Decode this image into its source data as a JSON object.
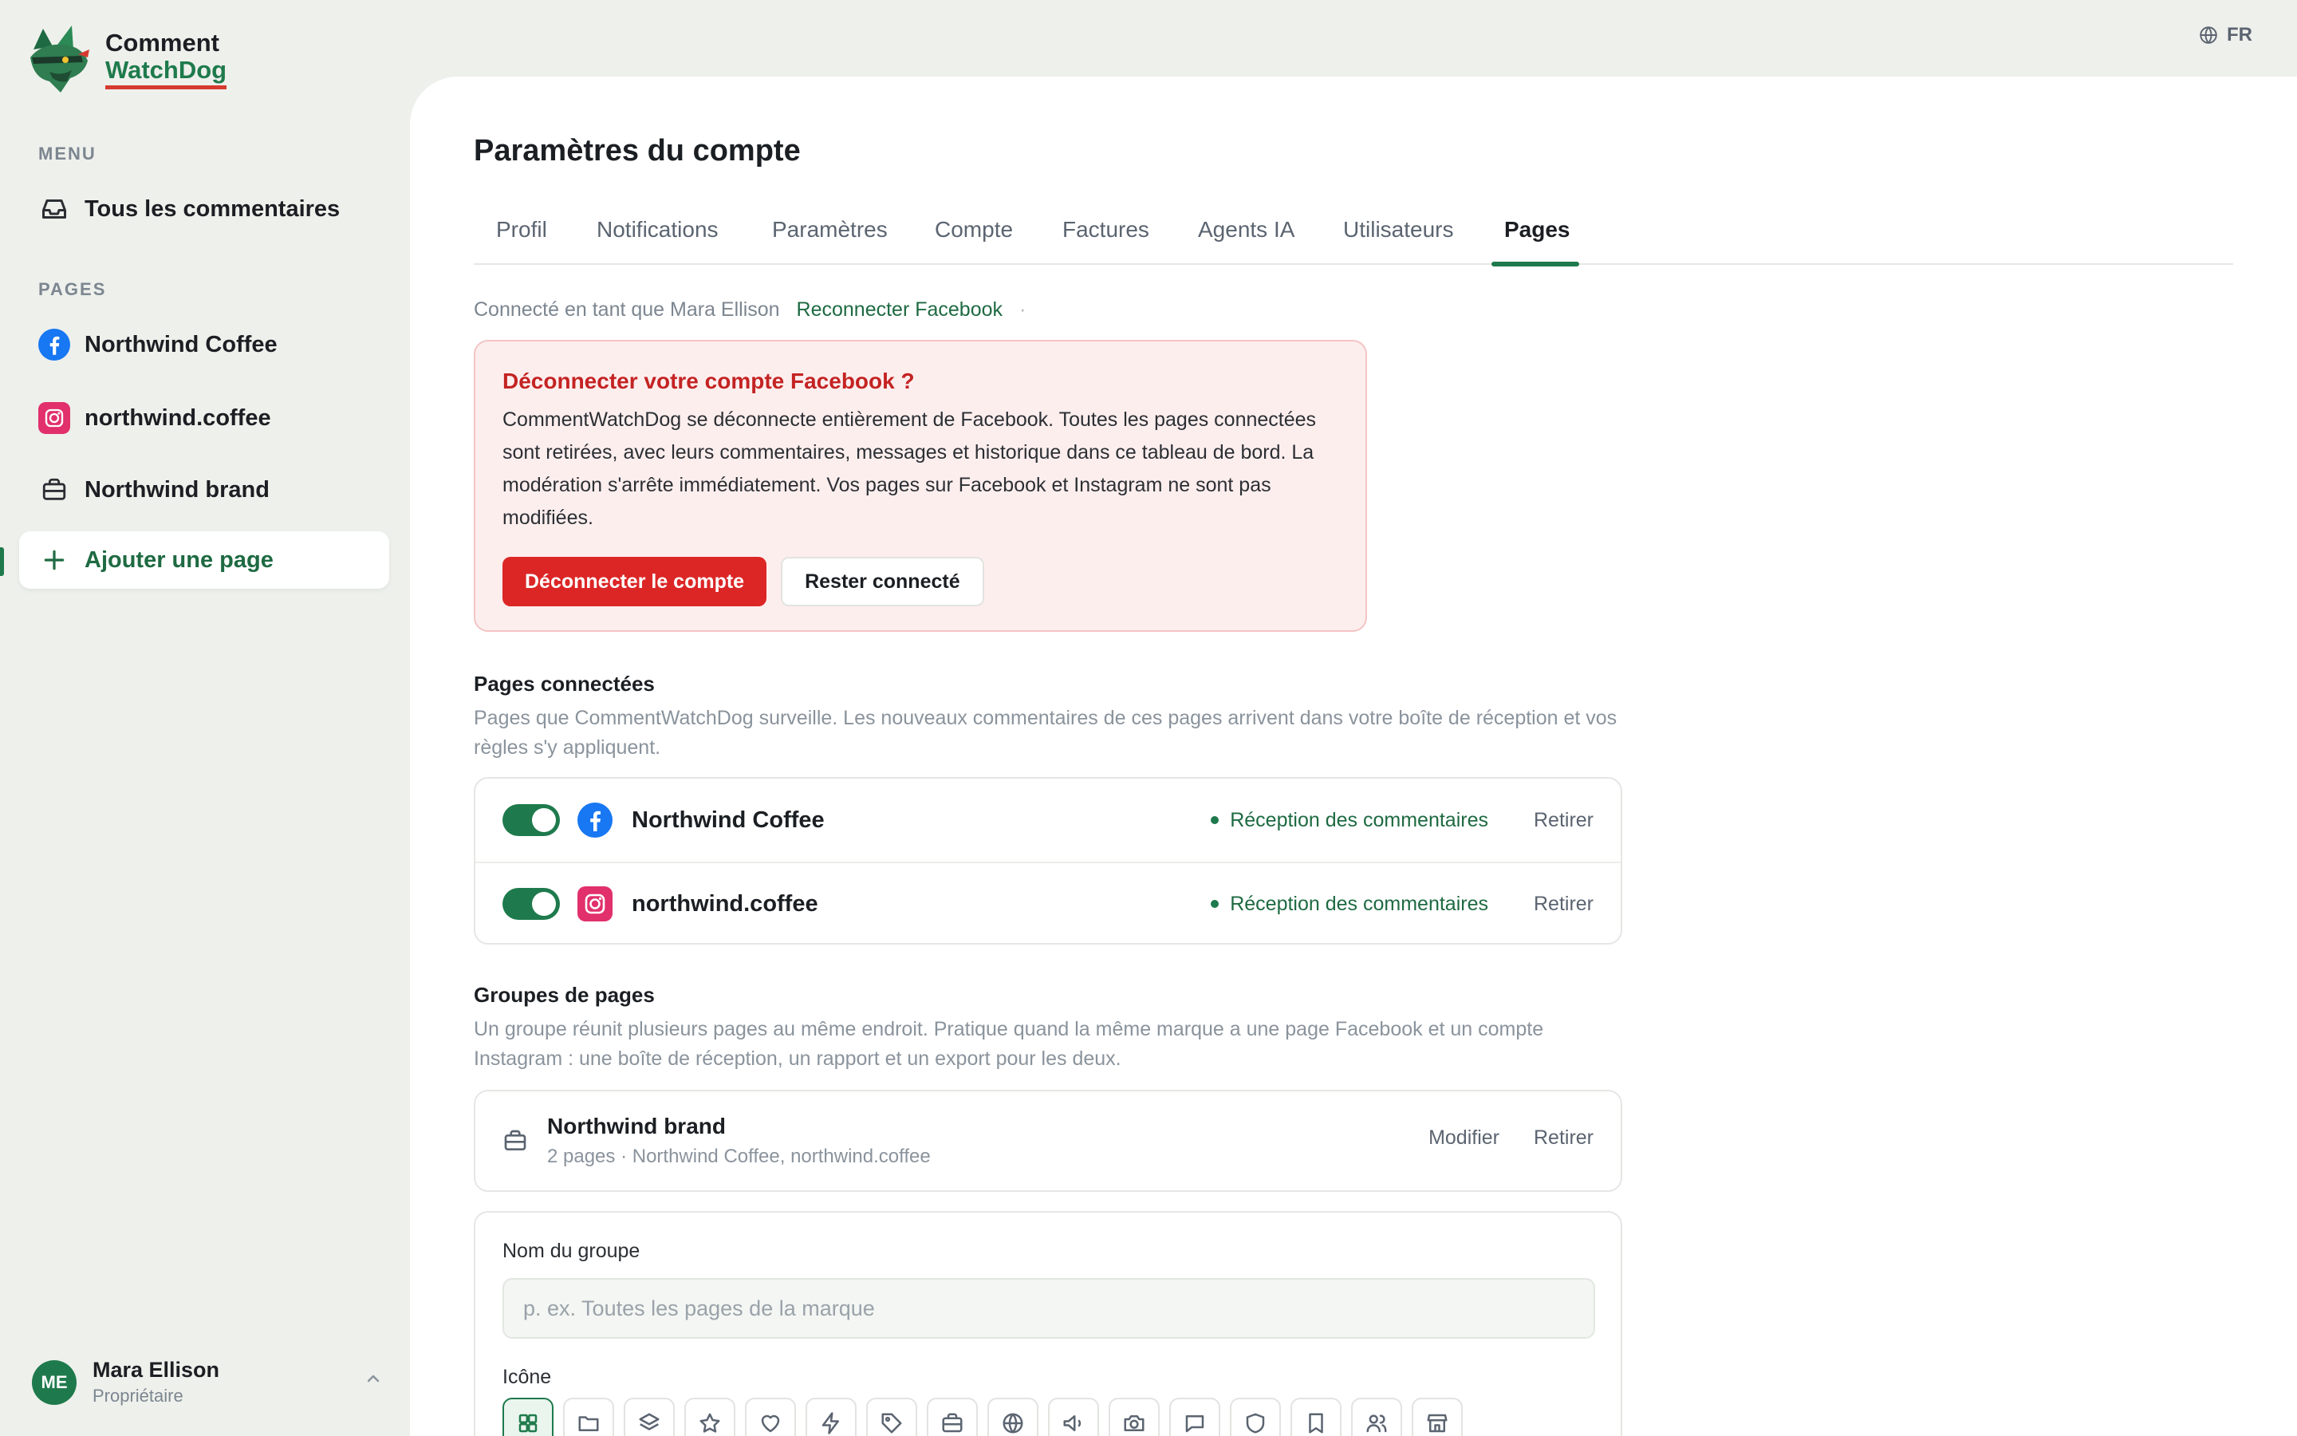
{
  "app": {
    "logo_line1": "Comment",
    "logo_line2": "WatchDog",
    "language": "FR"
  },
  "sidebar": {
    "menu_label": "MENU",
    "menu_items": [
      {
        "label": "Tous les commentaires",
        "icon": "inbox-icon"
      }
    ],
    "pages_label": "PAGES",
    "pages": [
      {
        "label": "Northwind Coffee",
        "icon": "facebook-icon"
      },
      {
        "label": "northwind.coffee",
        "icon": "instagram-icon"
      },
      {
        "label": "Northwind brand",
        "icon": "briefcase-icon"
      }
    ],
    "add_page_label": "Ajouter une page",
    "user": {
      "initials": "ME",
      "name": "Mara Ellison",
      "role": "Propriétaire"
    }
  },
  "main": {
    "title": "Paramètres du compte",
    "tabs": [
      {
        "label": "Profil"
      },
      {
        "label": "Notifications"
      },
      {
        "label": "Paramètres"
      },
      {
        "label": "Compte"
      },
      {
        "label": "Factures"
      },
      {
        "label": "Agents IA"
      },
      {
        "label": "Utilisateurs"
      },
      {
        "label": "Pages"
      }
    ],
    "active_tab": "Pages",
    "connected_as": "Connecté en tant que Mara Ellison",
    "reconnect_label": "Reconnecter Facebook",
    "separator": "·",
    "disconnect_alert": {
      "title": "Déconnecter votre compte Facebook ?",
      "body": "CommentWatchDog se déconnecte entièrement de Facebook. Toutes les pages connectées sont retirées, avec leurs commentaires, messages et historique dans ce tableau de bord. La modération s'arrête immédiatement. Vos pages sur Facebook et Instagram ne sont pas modifiées.",
      "confirm_label": "Déconnecter le compte",
      "cancel_label": "Rester connecté"
    },
    "connected_pages": {
      "title": "Pages connectées",
      "description": "Pages que CommentWatchDog surveille. Les nouveaux commentaires de ces pages arrivent dans votre boîte de réception et vos règles s'y appliquent.",
      "items": [
        {
          "name": "Northwind Coffee",
          "platform": "facebook-icon",
          "enabled": true,
          "status": "Réception des commentaires",
          "remove_label": "Retirer"
        },
        {
          "name": "northwind.coffee",
          "platform": "instagram-icon",
          "enabled": true,
          "status": "Réception des commentaires",
          "remove_label": "Retirer"
        }
      ]
    },
    "page_groups": {
      "title": "Groupes de pages",
      "description": "Un groupe réunit plusieurs pages au même endroit. Pratique quand la même marque a une page Facebook et un compte Instagram : une boîte de réception, un rapport et un export pour les deux.",
      "items": [
        {
          "name": "Northwind brand",
          "subtitle": "2 pages · Northwind Coffee, northwind.coffee",
          "edit_label": "Modifier",
          "remove_label": "Retirer"
        }
      ],
      "form": {
        "name_label": "Nom du groupe",
        "name_value": "",
        "name_placeholder": "p. ex. Toutes les pages de la marque",
        "icon_label": "Icône",
        "icon_options": [
          "grid-icon",
          "folder-icon",
          "layers-icon",
          "star-icon",
          "heart-icon",
          "bolt-icon",
          "tag-icon",
          "briefcase-icon",
          "globe-icon",
          "megaphone-icon",
          "camera-icon",
          "chat-icon",
          "shield-icon",
          "bookmark-icon",
          "users-icon",
          "store-icon"
        ],
        "selected_icon": "grid-icon"
      }
    }
  },
  "colors": {
    "accent": "#1e7a4c",
    "danger": "#dc2626",
    "background": "#eef0ec",
    "facebook": "#1877f2",
    "instagram": "#e1306c"
  }
}
